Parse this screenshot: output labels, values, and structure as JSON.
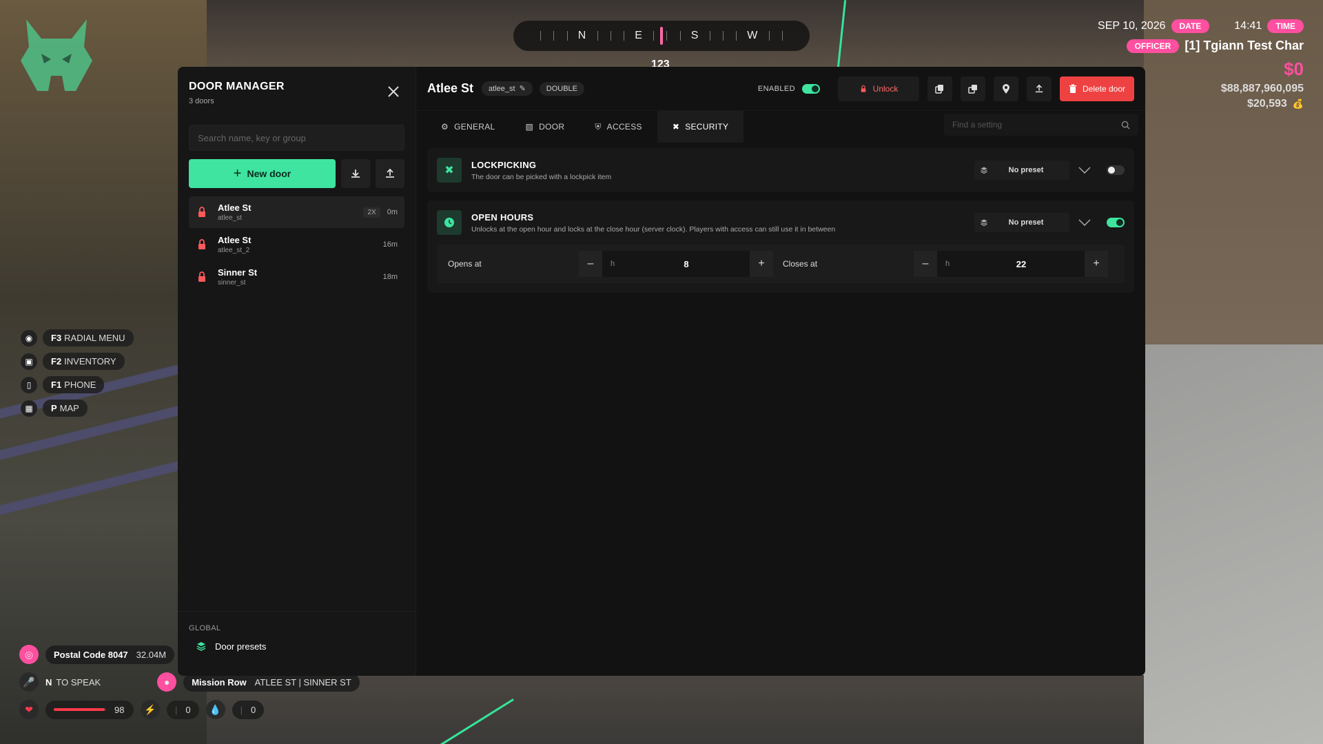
{
  "compass": {
    "directions": [
      "N",
      "E",
      "S",
      "W"
    ],
    "heading": "123"
  },
  "hud": {
    "date": "SEP 10, 2026",
    "date_badge": "DATE",
    "time": "14:41",
    "time_badge": "TIME",
    "role_badge": "OFFICER",
    "character": "[1] Tgiann Test Char",
    "cash": "$0",
    "bank": "$88,887,960,095",
    "wallet": "$20,593"
  },
  "keybinds": [
    {
      "key": "F3",
      "label": "RADIAL MENU"
    },
    {
      "key": "F2",
      "label": "INVENTORY"
    },
    {
      "key": "F1",
      "label": "PHONE"
    },
    {
      "key": "P",
      "label": "MAP"
    }
  ],
  "status": {
    "postal": "Postal Code 8047",
    "postal_distance": "32.04M",
    "voice": "N",
    "voice_label": "TO SPEAK",
    "location": "Mission Row",
    "streets": "ATLEE ST | SINNER ST",
    "health": "98",
    "stamina": "0",
    "thirst": "0",
    "health_level": 0.98
  },
  "sidebar": {
    "title": "DOOR MANAGER",
    "count": "3 doors",
    "search_placeholder": "Search name, key or group",
    "new_door": "New door",
    "doors": [
      {
        "name": "Atlee St",
        "key": "atlee_st",
        "badge": "2X",
        "time": "0m"
      },
      {
        "name": "Atlee St",
        "key": "atlee_st_2",
        "badge": "",
        "time": "16m"
      },
      {
        "name": "Sinner St",
        "key": "sinner_st",
        "badge": "",
        "time": "18m"
      }
    ],
    "global_label": "GLOBAL",
    "presets_label": "Door presets"
  },
  "door": {
    "title": "Atlee St",
    "key": "atlee_st",
    "type": "DOUBLE",
    "enabled_label": "ENABLED",
    "unlock": "Unlock",
    "delete": "Delete door"
  },
  "tabs": [
    {
      "label": "GENERAL",
      "icon": "gear-icon"
    },
    {
      "label": "DOOR",
      "icon": "door-icon"
    },
    {
      "label": "ACCESS",
      "icon": "shield-icon"
    },
    {
      "label": "SECURITY",
      "icon": "tools-icon"
    }
  ],
  "settings_search_placeholder": "Find a setting",
  "security": {
    "lockpicking": {
      "title": "LOCKPICKING",
      "desc": "The door can be picked with a lockpick item",
      "preset": "No preset"
    },
    "open_hours": {
      "title": "OPEN HOURS",
      "desc": "Unlocks at the open hour and locks at the close hour (server clock). Players with access can still use it in between",
      "preset": "No preset",
      "opens_label": "Opens at",
      "opens_value": "8",
      "closes_label": "Closes at",
      "closes_value": "22",
      "unit": "h"
    }
  },
  "colors": {
    "accent": "#3ee4a0",
    "pink": "#ff4fa0",
    "danger": "#ee4242"
  }
}
